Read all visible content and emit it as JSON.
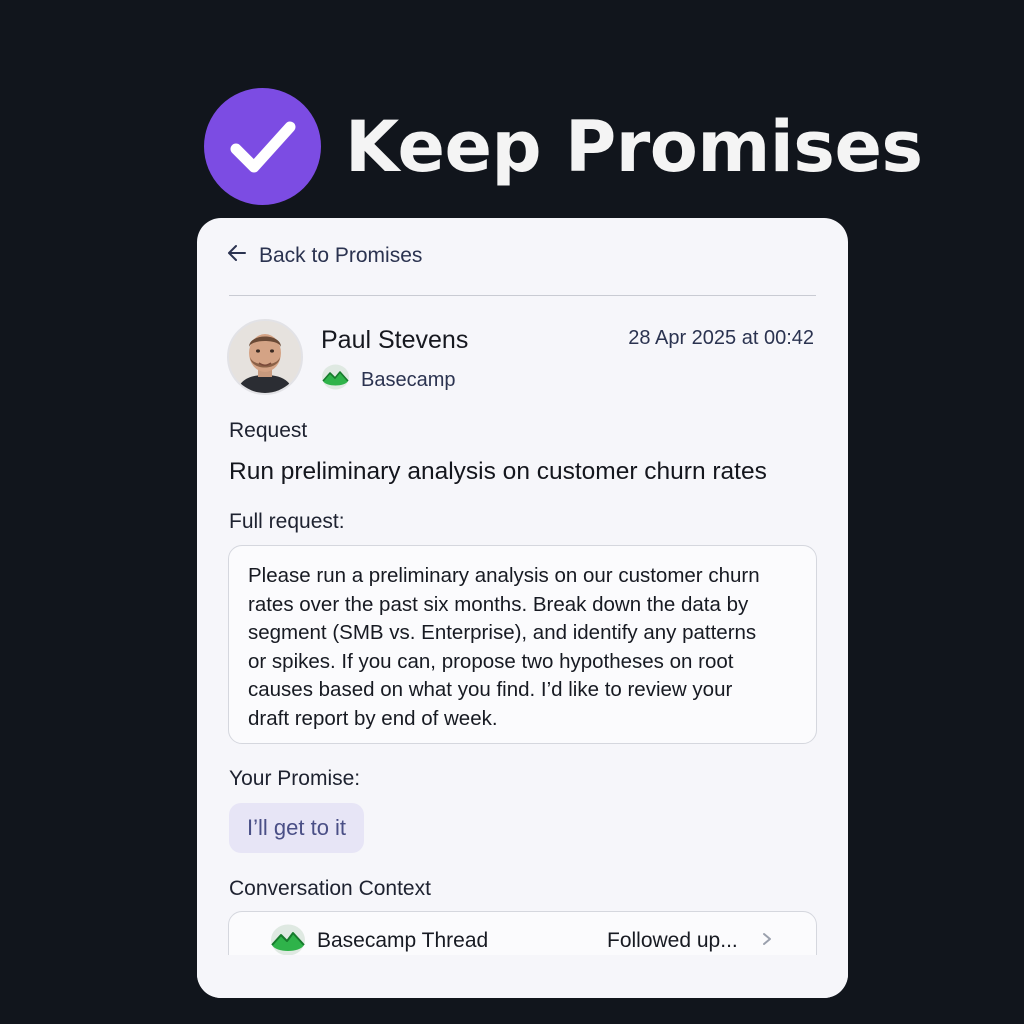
{
  "brand": {
    "title": "Keep Promises",
    "accent": "#7c4ce3"
  },
  "nav": {
    "back_label": "Back to Promises"
  },
  "sender": {
    "name": "Paul Stevens",
    "source_app": "Basecamp",
    "timestamp": "28 Apr 2025 at 00:42"
  },
  "request": {
    "label": "Request",
    "title": "Run preliminary analysis on customer churn rates",
    "full_label": "Full request:",
    "full_lines": [
      "Please run a preliminary analysis on our customer churn",
      "rates over the past six months. Break down the data by",
      "segment (SMB vs. Enterprise), and identify any patterns",
      "or spikes. If you can, propose two hypotheses on root",
      "causes based on what you find. I’d like to review your",
      "draft report by end of week."
    ]
  },
  "promise": {
    "label": "Your Promise:",
    "value": "I’ll get to it"
  },
  "context": {
    "label": "Conversation Context",
    "items": [
      {
        "title": "Basecamp Thread",
        "status": "Followed up...",
        "icon": "basecamp-icon"
      }
    ]
  },
  "colors": {
    "background": "#11151c",
    "card": "#f6f6fa",
    "chip": "#e7e5f6",
    "basecamp_green": "#2fb34a"
  }
}
